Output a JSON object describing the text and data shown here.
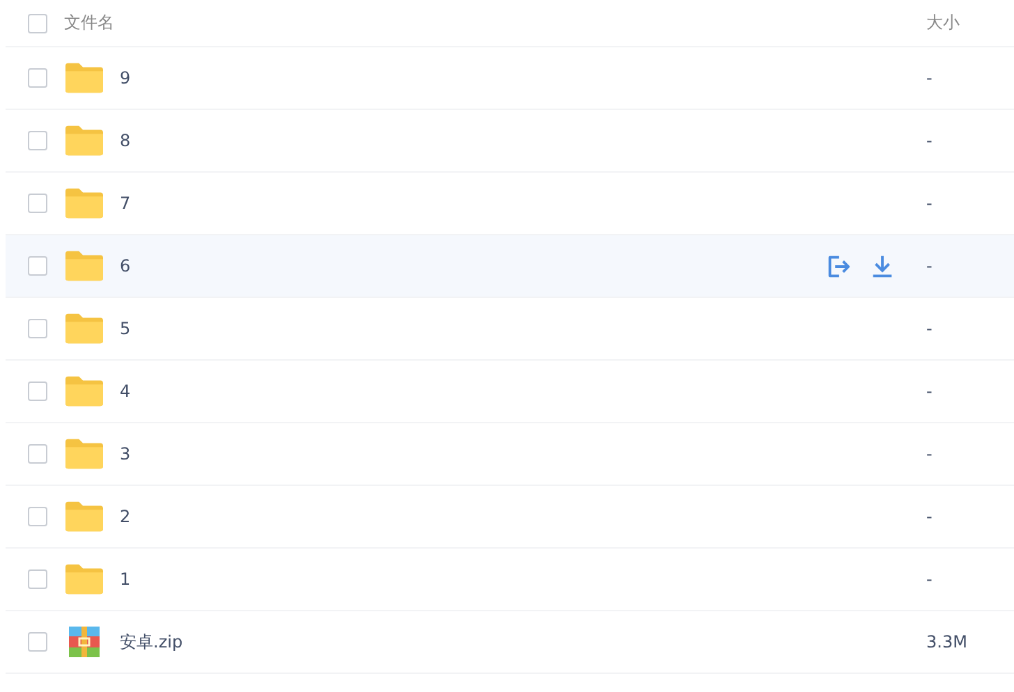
{
  "header": {
    "checked": false,
    "name": "文件名",
    "size": "大小"
  },
  "rows": [
    {
      "kind": "folder",
      "name": "9",
      "size": "-",
      "checked": false,
      "hovered": false
    },
    {
      "kind": "folder",
      "name": "8",
      "size": "-",
      "checked": false,
      "hovered": false
    },
    {
      "kind": "folder",
      "name": "7",
      "size": "-",
      "checked": false,
      "hovered": false
    },
    {
      "kind": "folder",
      "name": "6",
      "size": "-",
      "checked": false,
      "hovered": true
    },
    {
      "kind": "folder",
      "name": "5",
      "size": "-",
      "checked": false,
      "hovered": false
    },
    {
      "kind": "folder",
      "name": "4",
      "size": "-",
      "checked": false,
      "hovered": false
    },
    {
      "kind": "folder",
      "name": "3",
      "size": "-",
      "checked": false,
      "hovered": false
    },
    {
      "kind": "folder",
      "name": "2",
      "size": "-",
      "checked": false,
      "hovered": false
    },
    {
      "kind": "folder",
      "name": "1",
      "size": "-",
      "checked": false,
      "hovered": false
    },
    {
      "kind": "archive",
      "name": "安卓.zip",
      "size": "3.3M",
      "checked": false,
      "hovered": false
    }
  ]
}
